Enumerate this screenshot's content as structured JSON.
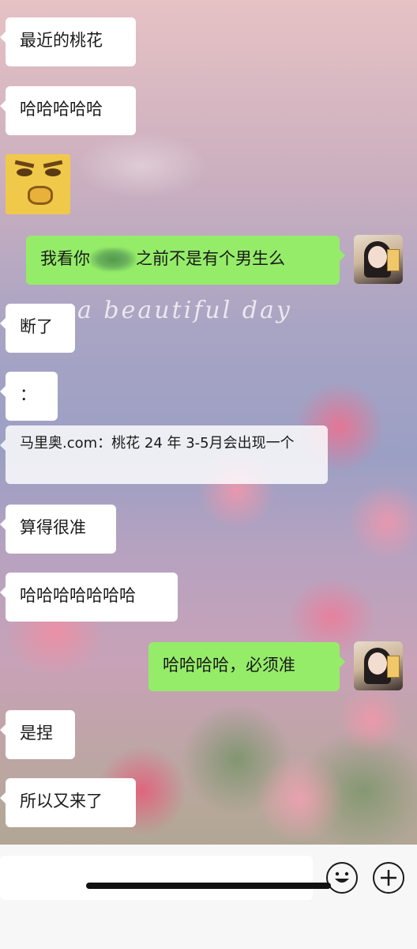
{
  "messages": [
    {
      "side": "left",
      "type": "text",
      "text": "最近的桃花"
    },
    {
      "side": "left",
      "type": "text",
      "text": "哈哈哈哈哈"
    },
    {
      "side": "left",
      "type": "sticker",
      "icon": "yellow-face-sticker-icon"
    },
    {
      "side": "right",
      "type": "text",
      "text_before": "我看你",
      "text_after": "之前不是有个男生么"
    },
    {
      "side": "left",
      "type": "text",
      "text": "断了"
    },
    {
      "side": "left",
      "type": "text",
      "text": "："
    },
    {
      "side": "left",
      "type": "text",
      "text": "马里奥.com：桃花 24 年 3-5月会出现一个"
    },
    {
      "side": "left",
      "type": "text",
      "text": "算得很准"
    },
    {
      "side": "left",
      "type": "text",
      "text": "哈哈哈哈哈哈哈"
    },
    {
      "side": "right",
      "type": "text",
      "text": "哈哈哈哈，必须准"
    },
    {
      "side": "left",
      "type": "text",
      "text": "是捏"
    },
    {
      "side": "left",
      "type": "text",
      "text": "所以又来了"
    }
  ],
  "background": {
    "script_text": "a beautiful day"
  },
  "input_bar": {
    "value": "",
    "emoji_icon": "emoji-face-icon",
    "plus_icon": "plus-icon"
  },
  "colors": {
    "sent_bubble": "#95ec69",
    "received_bubble": "#ffffff",
    "input_bar_bg": "#f7f7f7"
  }
}
